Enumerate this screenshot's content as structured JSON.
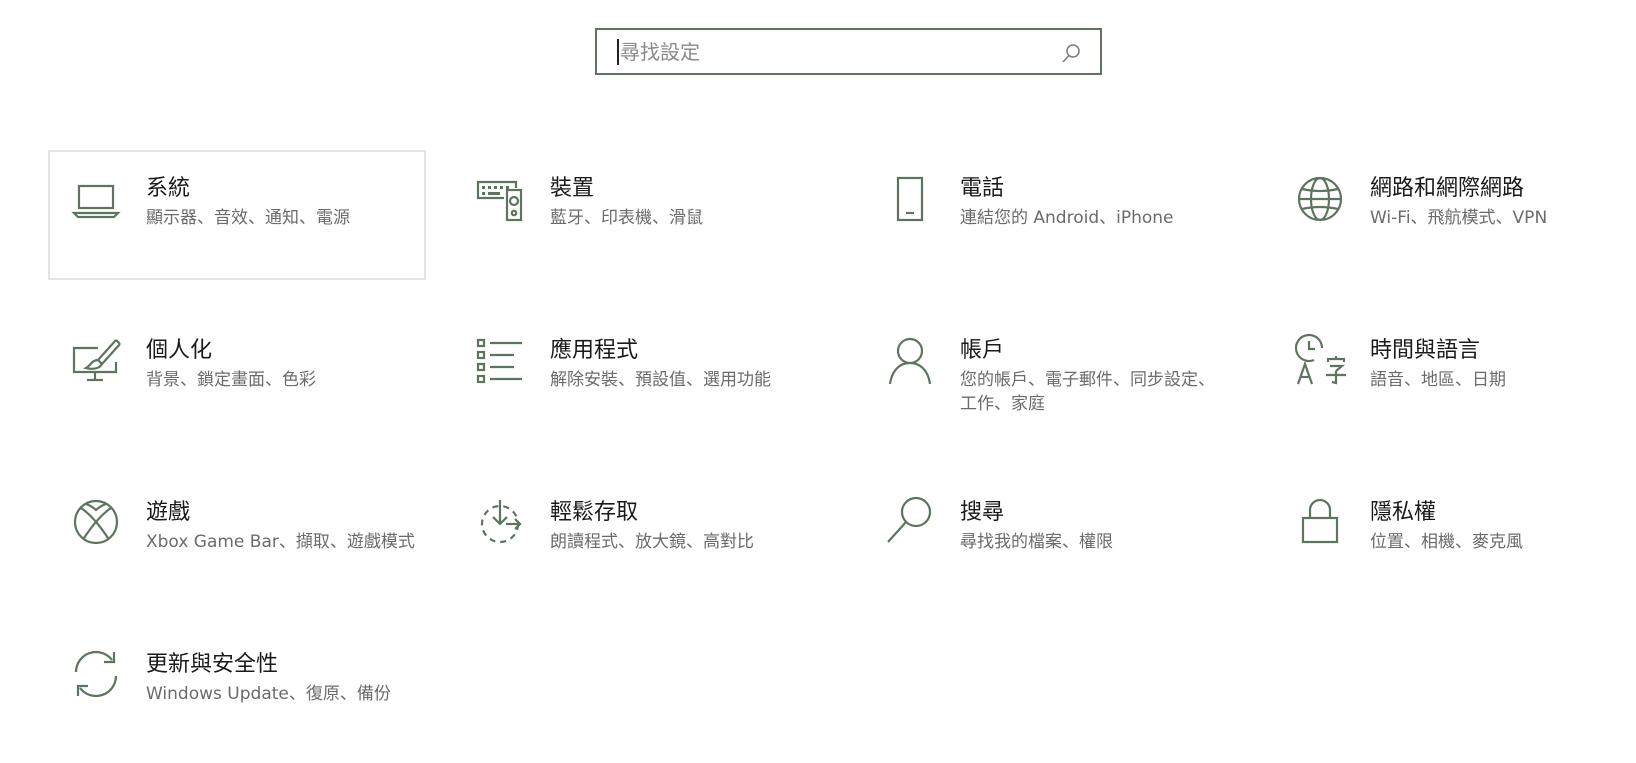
{
  "search": {
    "placeholder": "尋找設定",
    "icon": "search-icon"
  },
  "accent_color": "#5d745e",
  "tiles": [
    {
      "title": "系統",
      "desc": "顯示器、音效、通知、電源",
      "icon": "laptop-icon"
    },
    {
      "title": "裝置",
      "desc": "藍牙、印表機、滑鼠",
      "icon": "keyboard-speaker-icon"
    },
    {
      "title": "電話",
      "desc": "連結您的 Android、iPhone",
      "icon": "phone-icon"
    },
    {
      "title": "網路和網際網路",
      "desc": "Wi-Fi、飛航模式、VPN",
      "icon": "globe-icon"
    },
    {
      "title": "個人化",
      "desc": "背景、鎖定畫面、色彩",
      "icon": "paint-brush-icon"
    },
    {
      "title": "應用程式",
      "desc": "解除安裝、預設值、選用功能",
      "icon": "apps-list-icon"
    },
    {
      "title": "帳戶",
      "desc": "您的帳戶、電子郵件、同步設定、工作、家庭",
      "icon": "person-icon"
    },
    {
      "title": "時間與語言",
      "desc": "語音、地區、日期",
      "icon": "time-language-icon"
    },
    {
      "title": "遊戲",
      "desc": "Xbox Game Bar、擷取、遊戲模式",
      "icon": "xbox-icon"
    },
    {
      "title": "輕鬆存取",
      "desc": "朗讀程式、放大鏡、高對比",
      "icon": "ease-of-access-icon"
    },
    {
      "title": "搜尋",
      "desc": "尋找我的檔案、權限",
      "icon": "search-magnifier-icon"
    },
    {
      "title": "隱私權",
      "desc": "位置、相機、麥克風",
      "icon": "lock-icon"
    },
    {
      "title": "更新與安全性",
      "desc": "Windows Update、復原、備份",
      "icon": "sync-icon"
    }
  ]
}
